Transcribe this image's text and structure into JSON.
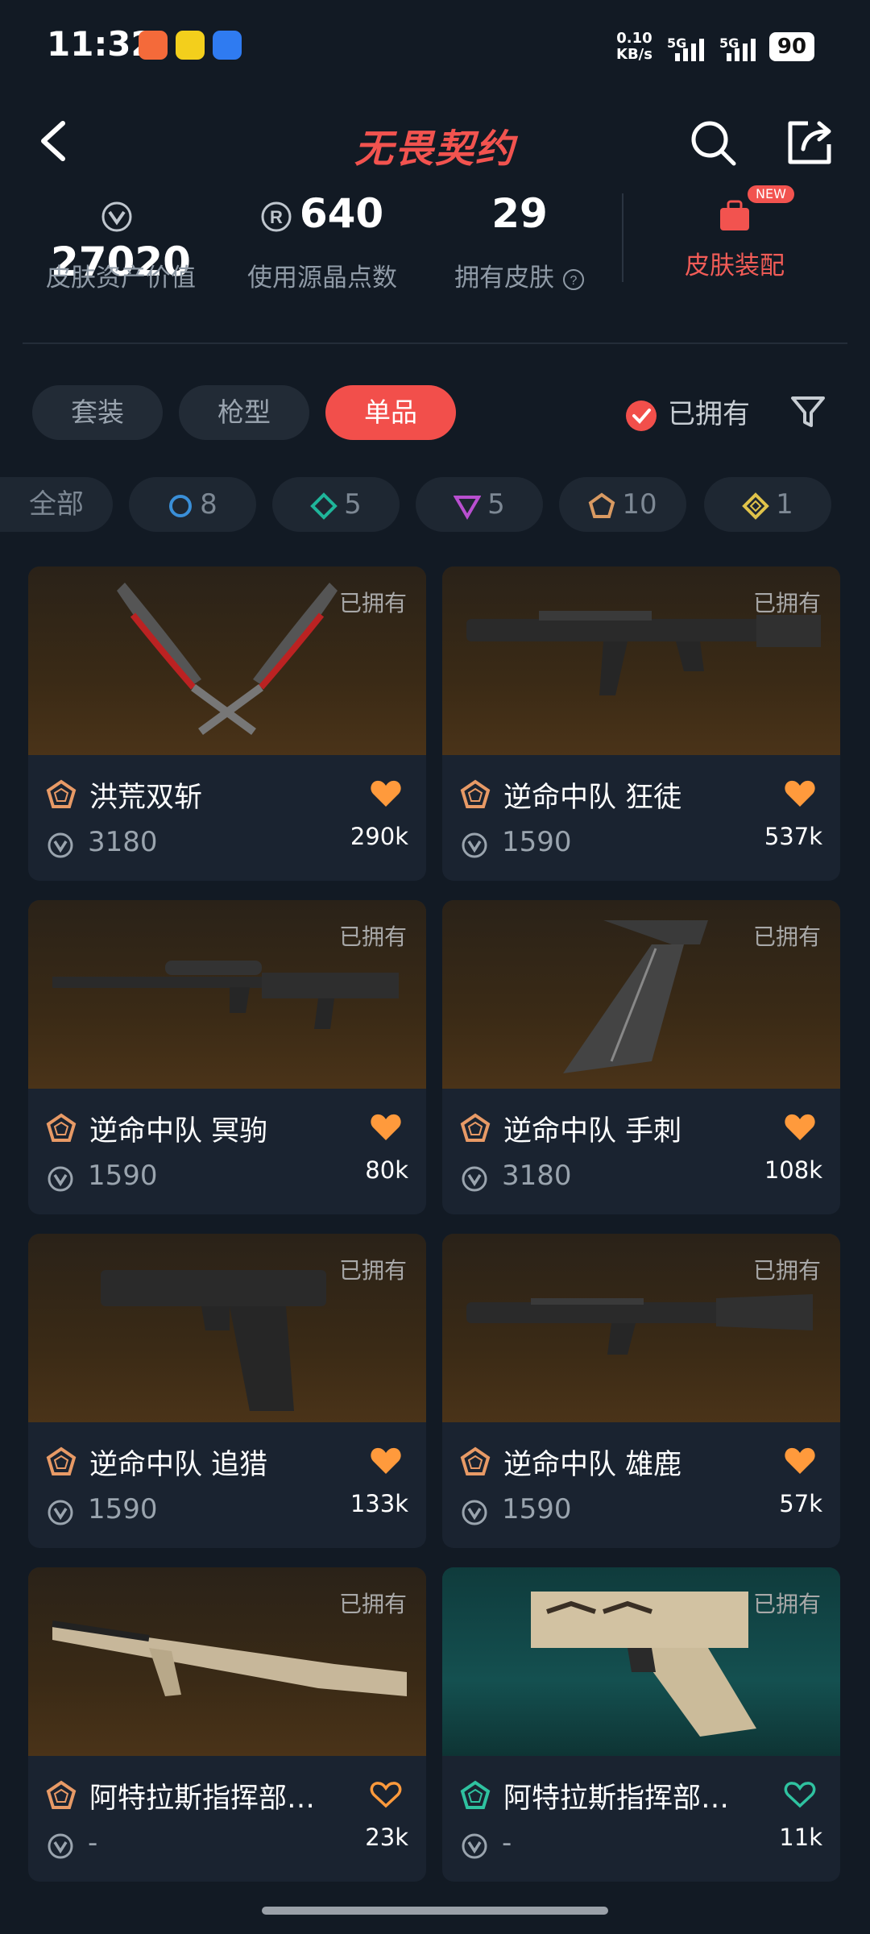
{
  "status_bar": {
    "time": "11:32",
    "net_speed": "0.10",
    "net_unit": "KB/s",
    "sim1": "5G",
    "sim2": "5G",
    "battery": "90"
  },
  "header": {
    "title": "无畏契约"
  },
  "stats": {
    "asset_value": "27020",
    "asset_value_label": "皮肤资产价值",
    "radianite_points": "640",
    "radianite_label": "使用源晶点数",
    "skins_owned": "29",
    "skins_owned_label": "拥有皮肤",
    "outfit_label": "皮肤装配",
    "outfit_badge": "NEW"
  },
  "tabs": [
    {
      "label": "套装",
      "active": false
    },
    {
      "label": "枪型",
      "active": false
    },
    {
      "label": "单品",
      "active": true
    }
  ],
  "owned_filter_label": "已拥有",
  "chips": [
    {
      "label": "全部",
      "count": ""
    },
    {
      "label": "",
      "count": "8",
      "color": "#3a8fd8"
    },
    {
      "label": "",
      "count": "5",
      "color": "#1fb59a"
    },
    {
      "label": "",
      "count": "5",
      "color": "#b94fd0"
    },
    {
      "label": "",
      "count": "10",
      "color": "#d99a62"
    },
    {
      "label": "",
      "count": "1",
      "color": "#e0c34a"
    }
  ],
  "cards": [
    {
      "name": "洪荒双斩",
      "price": "3180",
      "likes": "290k",
      "owned": "已拥有",
      "tier_color": "#e89a66",
      "heart": "filled",
      "weapon": "knife-pair"
    },
    {
      "name": "逆命中队 狂徒",
      "price": "1590",
      "likes": "537k",
      "owned": "已拥有",
      "tier_color": "#e89a66",
      "heart": "filled",
      "weapon": "rifle"
    },
    {
      "name": "逆命中队 冥驹",
      "price": "1590",
      "likes": "80k",
      "owned": "已拥有",
      "tier_color": "#e89a66",
      "heart": "filled",
      "weapon": "sniper"
    },
    {
      "name": "逆命中队 手刺",
      "price": "3180",
      "likes": "108k",
      "owned": "已拥有",
      "tier_color": "#e89a66",
      "heart": "filled",
      "weapon": "dagger"
    },
    {
      "name": "逆命中队 追猎",
      "price": "1590",
      "likes": "133k",
      "owned": "已拥有",
      "tier_color": "#e89a66",
      "heart": "filled",
      "weapon": "pistol"
    },
    {
      "name": "逆命中队 雄鹿",
      "price": "1590",
      "likes": "57k",
      "owned": "已拥有",
      "tier_color": "#e89a66",
      "heart": "filled",
      "weapon": "shotgun"
    },
    {
      "name": "阿特拉斯指挥部…",
      "price": "-",
      "likes": "23k",
      "owned": "已拥有",
      "tier_color": "#e89a66",
      "heart": "outline",
      "weapon": "atlas-rifle"
    },
    {
      "name": "阿特拉斯指挥部…",
      "price": "-",
      "likes": "11k",
      "owned": "已拥有",
      "tier_color": "#2fc2a0",
      "heart": "outline-teal",
      "weapon": "atlas-pistol"
    }
  ]
}
